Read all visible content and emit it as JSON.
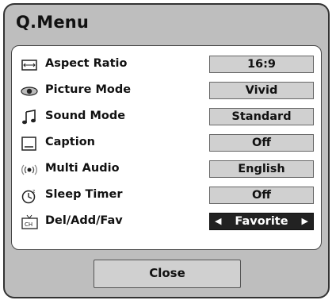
{
  "menu": {
    "title": "Q.Menu",
    "close_label": "Close",
    "items": [
      {
        "label": "Aspect Ratio",
        "value": "16:9",
        "icon": "aspect-ratio-icon"
      },
      {
        "label": "Picture Mode",
        "value": "Vivid",
        "icon": "eye-icon"
      },
      {
        "label": "Sound Mode",
        "value": "Standard",
        "icon": "music-note-icon"
      },
      {
        "label": "Caption",
        "value": "Off",
        "icon": "caption-icon"
      },
      {
        "label": "Multi Audio",
        "value": "English",
        "icon": "audio-waves-icon"
      },
      {
        "label": "Sleep Timer",
        "value": "Off",
        "icon": "clock-icon"
      },
      {
        "label": "Del/Add/Fav",
        "value": "Favorite",
        "icon": "ch-icon",
        "selected": true,
        "arrow_left": "◀",
        "arrow_right": "▶",
        "icon_text": "CH"
      }
    ]
  }
}
